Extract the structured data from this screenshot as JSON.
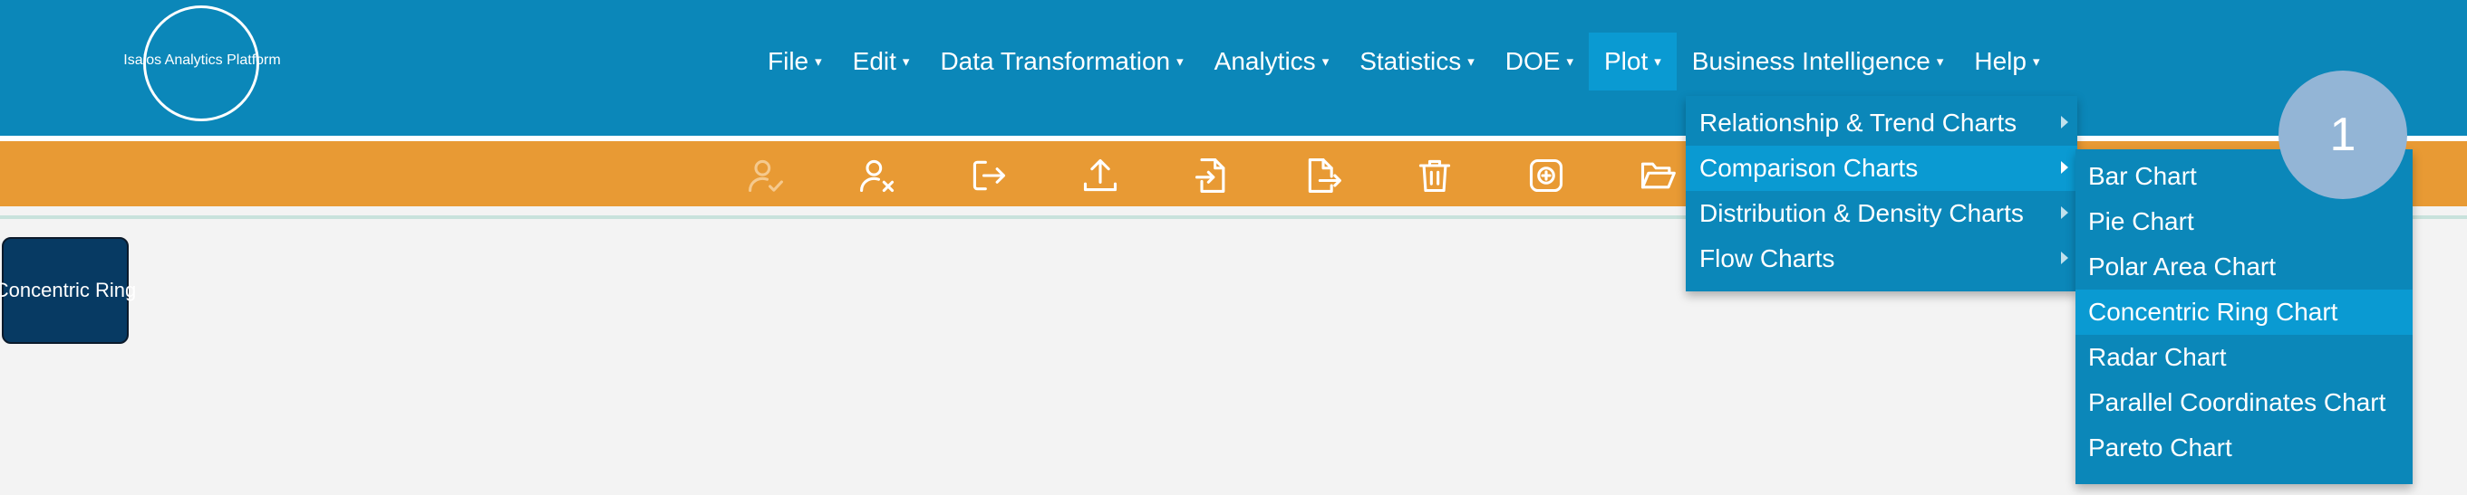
{
  "app": {
    "logo_text": "Isalos Analytics Platform"
  },
  "menu": [
    {
      "id": "file",
      "label": "File"
    },
    {
      "id": "edit",
      "label": "Edit"
    },
    {
      "id": "data-transformation",
      "label": "Data Transformation"
    },
    {
      "id": "analytics",
      "label": "Analytics"
    },
    {
      "id": "statistics",
      "label": "Statistics"
    },
    {
      "id": "doe",
      "label": "DOE"
    },
    {
      "id": "plot",
      "label": "Plot",
      "active": true
    },
    {
      "id": "business-intelligence",
      "label": "Business Intelligence"
    },
    {
      "id": "help",
      "label": "Help"
    }
  ],
  "menu_caret": "▾",
  "toolbar": {
    "icons": [
      {
        "name": "user-check-icon",
        "disabled": true
      },
      {
        "name": "user-remove-icon"
      },
      {
        "name": "logout-icon"
      },
      {
        "name": "upload-icon"
      },
      {
        "name": "file-import-icon"
      },
      {
        "name": "file-export-icon"
      },
      {
        "name": "trash-icon"
      },
      {
        "name": "add-square-icon"
      },
      {
        "name": "folder-open-icon"
      }
    ]
  },
  "card": {
    "label": "Concentric Ring"
  },
  "plot_menu": {
    "items": [
      {
        "label": "Relationship & Trend Charts",
        "has_submenu": true
      },
      {
        "label": "Comparison Charts",
        "has_submenu": true,
        "active": true
      },
      {
        "label": "Distribution & Density Charts",
        "has_submenu": true
      },
      {
        "label": "Flow Charts",
        "has_submenu": true
      }
    ]
  },
  "comparison_submenu": {
    "items": [
      {
        "label": "Bar Chart"
      },
      {
        "label": "Pie Chart"
      },
      {
        "label": "Polar Area Chart"
      },
      {
        "label": "Concentric Ring Chart",
        "active": true
      },
      {
        "label": "Radar Chart"
      },
      {
        "label": "Parallel Coordinates Chart"
      },
      {
        "label": "Pareto Chart"
      }
    ]
  },
  "step_badge": "1",
  "colors": {
    "topbar": "#0b87b9",
    "toolbar": "#e89a34",
    "highlight": "#0a9ad2",
    "card": "#073a63",
    "badge": "#93b5d6"
  }
}
